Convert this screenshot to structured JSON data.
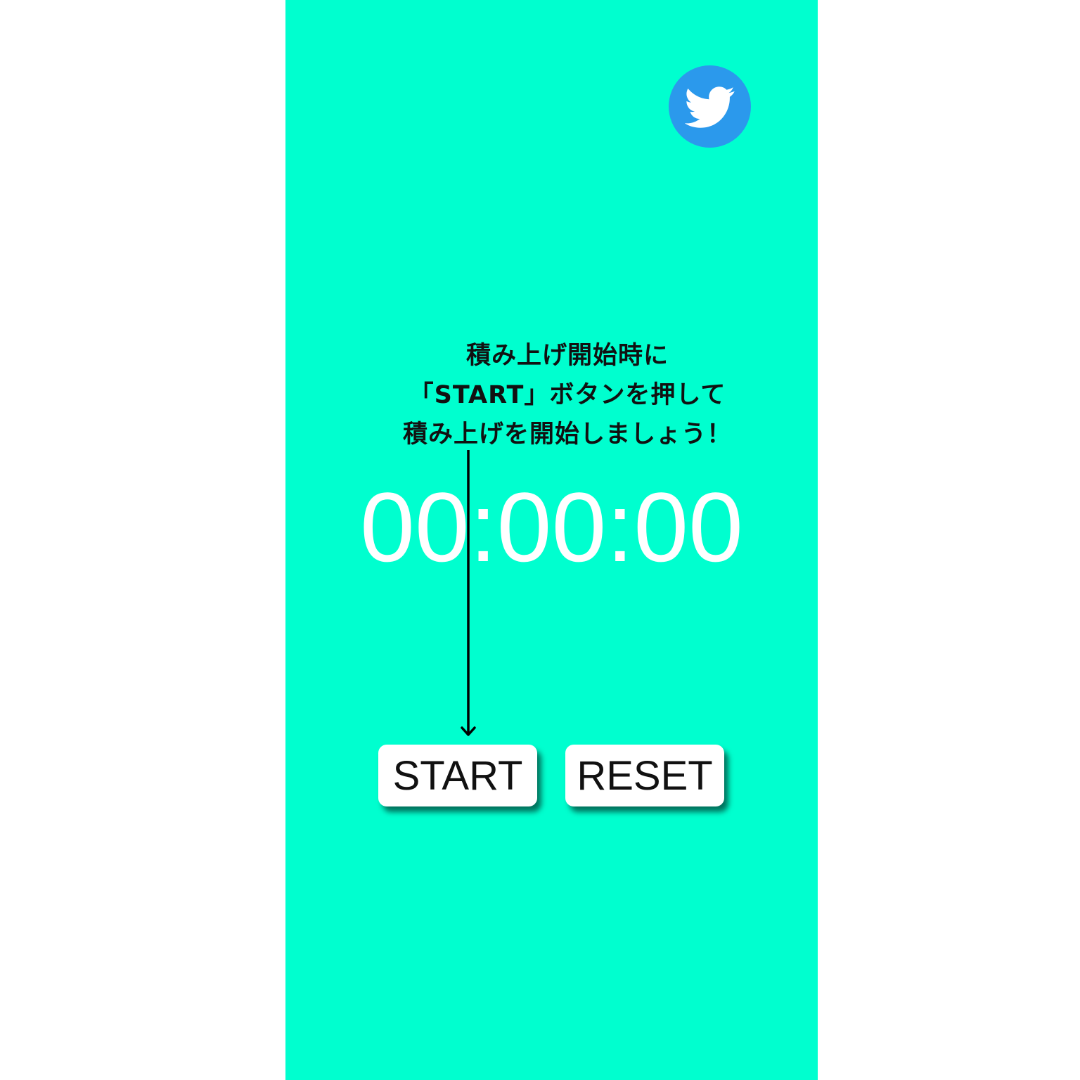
{
  "colors": {
    "background": "#00FFCF",
    "twitter_blue": "#2B99EC",
    "timer_text": "#FFFFFF",
    "instruction_text": "#111111"
  },
  "header": {
    "share_icon": "twitter-bird-icon"
  },
  "instruction": {
    "line1": "積み上げ開始時に",
    "line2": "「START」ボタンを押して",
    "line3": "積み上げを開始しましょう！"
  },
  "timer": {
    "display": "00:00:00"
  },
  "controls": {
    "start_label": "START",
    "reset_label": "RESET"
  }
}
